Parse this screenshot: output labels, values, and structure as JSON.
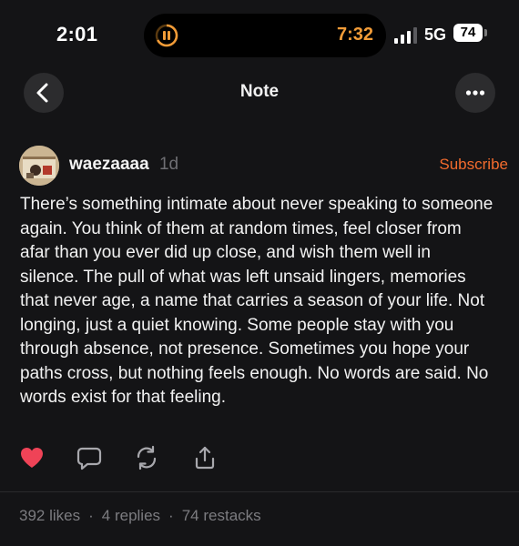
{
  "status_bar": {
    "time": "2:01",
    "activity_time": "7:32",
    "network": "5G",
    "battery": "74"
  },
  "nav": {
    "title": "Note",
    "back_icon": "chevron-left-icon",
    "more_icon": "ellipsis-icon"
  },
  "post": {
    "author": "waezaaaa",
    "age": "1d",
    "subscribe_label": "Subscribe",
    "body": "There’s something intimate about never speaking to someone again. You think of them at random times, feel closer from afar than you ever did up close, and wish them well in silence. The pull of what was left unsaid lingers, memories that never age, a name that carries a season of your life. Not longing, just a quiet knowing. Some people stay with you through absence, not presence. Sometimes you hope your paths cross, but nothing feels enough. No words are said. No words exist for that feeling."
  },
  "actions": {
    "like_icon": "heart-icon",
    "reply_icon": "comment-icon",
    "restack_icon": "restack-icon",
    "share_icon": "share-icon",
    "liked": true
  },
  "stats": {
    "likes": "392 likes",
    "replies": "4 replies",
    "restacks": "74 restacks",
    "separator": "·"
  },
  "colors": {
    "background": "#141416",
    "accent": "#f26b2d",
    "like": "#ef4357",
    "activity": "#f29c38",
    "muted": "#7c7c80"
  }
}
